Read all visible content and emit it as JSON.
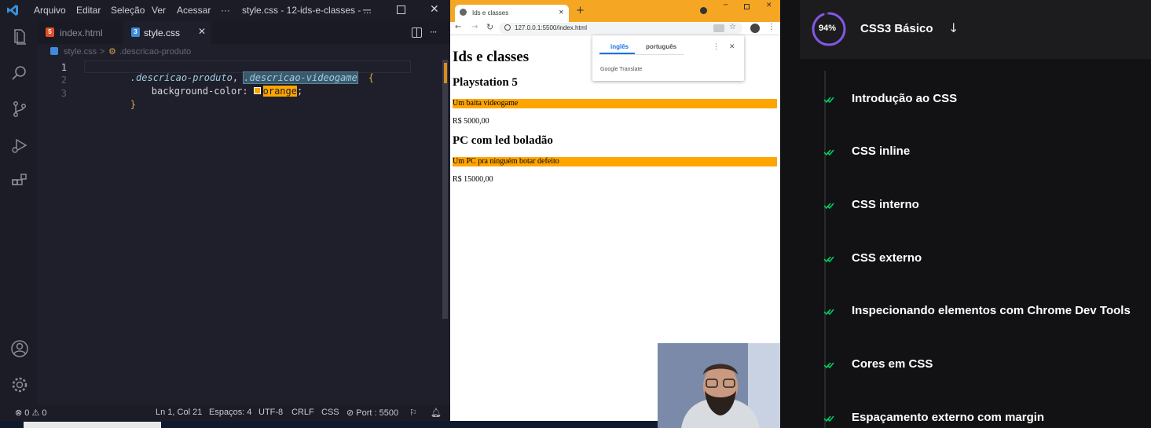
{
  "vscode": {
    "menu": [
      "Arquivo",
      "Editar",
      "Seleção",
      "Ver",
      "Acessar",
      "···"
    ],
    "window_title": "style.css - 12-ids-e-classes - ...",
    "tabs": [
      {
        "label": "index.html",
        "icon": "html-file-icon"
      },
      {
        "label": "style.css",
        "icon": "css-file-icon"
      }
    ],
    "close_glyph": "✕",
    "breadcrumb": {
      "file": "style.css",
      "sep": ">",
      "symbol": ".descricao-produto"
    },
    "code": {
      "line_numbers": [
        "1",
        "2",
        "3"
      ],
      "selector1": ".descricao-produto",
      "comma": ", ",
      "selector2": ".descricao-videogame",
      "brace_open": "{",
      "property": "background-color:",
      "value": "orange",
      "semicolon": ";",
      "brace_close": "}"
    },
    "status": {
      "problems": "⊗ 0 ⚠ 0",
      "position": "Ln 1, Col 21",
      "spaces": "Espaços: 4",
      "encoding": "UTF-8",
      "eol": "CRLF",
      "language": "CSS",
      "port": "⊘ Port : 5500"
    },
    "colors": {
      "accent": "#f5a623",
      "selector": "#9ecbe0",
      "property": "#d7d8de"
    }
  },
  "chrome": {
    "tab_title": "Ids e classes",
    "tab_close": "✕",
    "new_tab": "+",
    "url": "127.0.0.1:5500/index.html",
    "page": {
      "h1": "Ids e classes",
      "products": [
        {
          "name": "Playstation 5",
          "description": "Um baita videogame",
          "price": "R$ 5000,00"
        },
        {
          "name": "PC com led boladão",
          "description": "Um PC pra ninguém botar defeito",
          "price": "R$ 15000,00"
        }
      ]
    },
    "translate": {
      "tab_active": "inglês",
      "tab_other": "português",
      "brand": "Google Translate",
      "menu": "⋮",
      "close": "✕"
    },
    "highlight_color": "#ffa500"
  },
  "course": {
    "progress_label": "94%",
    "progress_value": 0.94,
    "title": "CSS3 Básico",
    "arrow": "↓",
    "lessons": [
      "Introdução ao CSS",
      "CSS inline",
      "CSS interno",
      "CSS externo",
      "Inspecionando elementos com Chrome Dev Tools",
      "Cores em CSS",
      "Espaçamento externo com margin"
    ],
    "colors": {
      "ring": "#8257e5",
      "check": "#04d361"
    }
  }
}
